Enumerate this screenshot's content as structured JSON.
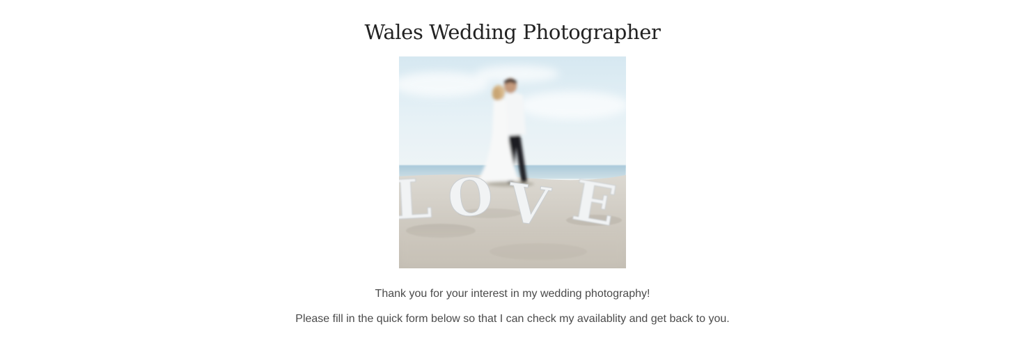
{
  "page": {
    "title": "Wales Wedding Photographer",
    "hero_image": {
      "subject": "couple-kissing-on-beach-with-love-letters",
      "sand_letters": "LOVE"
    },
    "intro_line_1": "Thank you for your interest in my wedding photography!",
    "intro_line_2": "Please fill in the quick form below so that I can check my availablity and get back to you."
  }
}
